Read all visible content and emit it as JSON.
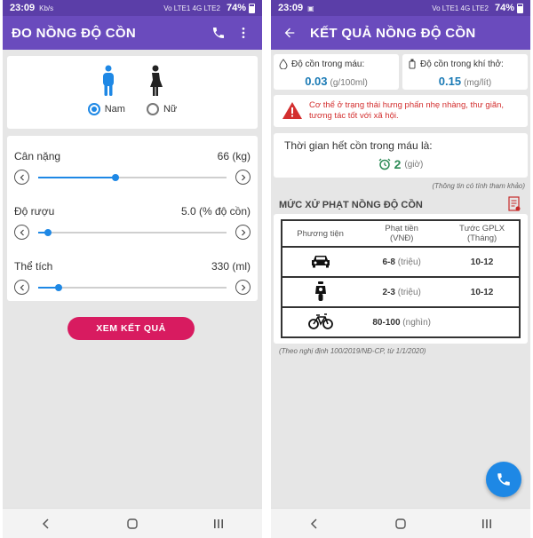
{
  "status_bar": {
    "time": "23:09",
    "small_left": "Kb/s",
    "small_right": "Vo LTE1 4G LTE2",
    "battery": "74%"
  },
  "left_screen": {
    "app_title": "ĐO NỒNG ĐỘ CỒN",
    "gender": {
      "options": [
        "Nam",
        "Nữ"
      ],
      "selected": "Nam"
    },
    "sliders": [
      {
        "label": "Cân nặng",
        "value_text": "66 (kg)",
        "level": 0.41
      },
      {
        "label": "Độ rượu",
        "value_text": "5.0 (% độ cồn)",
        "level": 0.05
      },
      {
        "label": "Thể tích",
        "value_text": "330 (ml)",
        "level": 0.11
      }
    ],
    "result_button": "XEM KẾT QUẢ"
  },
  "right_screen": {
    "app_title": "KẾT QUẢ NỒNG ĐỘ CỒN",
    "blood": {
      "label": "Độ cồn trong máu:",
      "value": "0.03",
      "unit": "(g/100ml)"
    },
    "breath": {
      "label": "Độ cồn trong khí thở:",
      "value": "0.15",
      "unit": "(mg/lít)"
    },
    "warning": "Cơ thể ở trạng thái hưng phấn nhẹ nhàng, thư giãn, tương tác tốt với xã hội.",
    "time": {
      "label": "Thời gian hết cồn trong máu là:",
      "value": "2",
      "unit": "(giờ)"
    },
    "reference_note": "(Thông tin có tính tham khảo)",
    "penalty_title": "MỨC XỬ PHẠT NỒNG ĐỘ CỒN",
    "table_headers": {
      "vehicle": "Phương tiện",
      "fine": "Phạt tiền",
      "fine_unit": "(VNĐ)",
      "license": "Tước GPLX",
      "license_unit": "(Tháng)"
    },
    "rows": [
      {
        "vehicle_icon": "car-icon",
        "fine": "6-8",
        "fine_unit": "(triệu)",
        "license": "10-12"
      },
      {
        "vehicle_icon": "motorbike-icon",
        "fine": "2-3",
        "fine_unit": "(triệu)",
        "license": "10-12"
      },
      {
        "vehicle_icon": "bicycle-icon",
        "fine": "80-100",
        "fine_unit": "(nghìn)",
        "license": ""
      }
    ],
    "decree_note": "(Theo nghị định 100/2019/NĐ-CP, từ 1/1/2020)"
  },
  "colors": {
    "status_bar": "#5b3ea8",
    "app_bar": "#6a4bbd",
    "accent_blue": "#1e88e5",
    "button_pink": "#d81b60",
    "warning_red": "#d32f2f",
    "value_blue": "#1a7ab5",
    "time_green": "#2e8b57"
  }
}
